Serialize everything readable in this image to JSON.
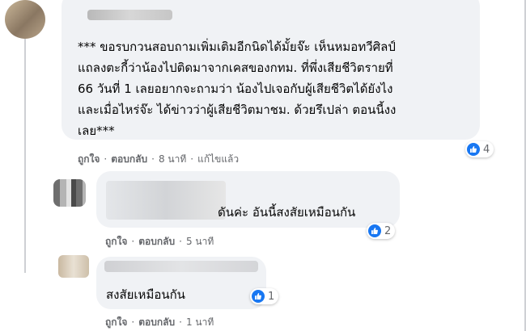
{
  "comments": [
    {
      "lines": [
        "*** ขอรบกวนสอบถามเพิ่มเติมอีกนิดได้มั้ยจ๊ะ เห็นหมอทวีศิลป์",
        "แถลงตะกี้ว่าน้องไปติดมาจากเคสของกทม. ที่พึ่งเสียชีวิตรายที่",
        "66 วันที่ 1 เลยอยากจะถามว่า น้องไปเจอกับผู้เสียชีวิตได้ยังไง",
        "และเมื่อไหร่จ๊ะ ได้ข่าวว่าผู้เสียชีวิตมาชม. ด้วยรึเปล่า ตอนนี้งง",
        "เลย***"
      ],
      "like_label": "ถูกใจ",
      "reply_label": "ตอบกลับ",
      "time": "8 นาที",
      "edited": "แก้ไขแล้ว",
      "reaction_count": "4"
    },
    {
      "text": "ดันค่ะ อันนี้สงสัยเหมือนกัน",
      "like_label": "ถูกใจ",
      "reply_label": "ตอบกลับ",
      "time": "5 นาที",
      "reaction_count": "2"
    },
    {
      "text": "สงสัยเหมือนกัน",
      "like_label": "ถูกใจ",
      "reply_label": "ตอบกลับ",
      "time": "1 นาที",
      "reaction_count": "1"
    }
  ],
  "colors": {
    "bubble": "#f0f2f5",
    "meta_text": "#65676b",
    "like_blue": "#1877f2"
  },
  "icons": {
    "like": "thumbs-up-icon"
  }
}
